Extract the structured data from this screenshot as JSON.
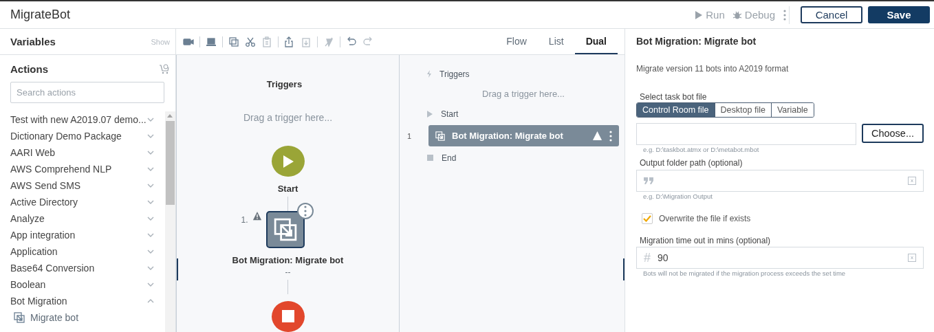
{
  "app": {
    "title": "MigrateBot"
  },
  "header_actions": {
    "run": "Run",
    "debug": "Debug",
    "cancel": "Cancel",
    "save": "Save"
  },
  "sidebar": {
    "variables_title": "Variables",
    "variables_toggle": "Show",
    "actions_title": "Actions",
    "search": {
      "placeholder": "Search actions"
    },
    "items": [
      {
        "label": "Test with new A2019.07 demo...",
        "expanded": false
      },
      {
        "label": "Dictionary Demo Package",
        "expanded": false
      },
      {
        "label": "AARI Web",
        "expanded": false
      },
      {
        "label": "AWS Comprehend NLP",
        "expanded": false
      },
      {
        "label": "AWS Send SMS",
        "expanded": false
      },
      {
        "label": "Active Directory",
        "expanded": false
      },
      {
        "label": "Analyze",
        "expanded": false
      },
      {
        "label": "App integration",
        "expanded": false
      },
      {
        "label": "Application",
        "expanded": false
      },
      {
        "label": "Base64 Conversion",
        "expanded": false
      },
      {
        "label": "Boolean",
        "expanded": false
      },
      {
        "label": "Bot Migration",
        "expanded": true,
        "children": [
          {
            "label": "Migrate bot"
          }
        ]
      }
    ]
  },
  "tabs": [
    {
      "label": "Flow",
      "selected": false
    },
    {
      "label": "List",
      "selected": false
    },
    {
      "label": "Dual",
      "selected": true
    }
  ],
  "flow": {
    "triggers_title": "Triggers",
    "trigger_hint": "Drag a trigger here...",
    "start_label": "Start",
    "step": {
      "number": "1.",
      "label": "Bot Migration: Migrate bot",
      "subtitle": "--",
      "warning": true,
      "selected": true
    }
  },
  "list": {
    "triggers": "Triggers",
    "trigger_hint": "Drag a trigger here...",
    "start": "Start",
    "rows": [
      {
        "number": "1",
        "label": "Bot Migration: Migrate bot",
        "warning": true,
        "selected": true
      }
    ],
    "end": "End"
  },
  "properties": {
    "title": "Bot Migration: Migrate bot",
    "description": "Migrate version 11 bots into A2019 format",
    "file_label": "Select task bot file",
    "file_sources": [
      {
        "label": "Control Room file",
        "selected": true
      },
      {
        "label": "Desktop file",
        "selected": false
      },
      {
        "label": "Variable",
        "selected": false
      }
    ],
    "choose": "Choose...",
    "file_hint": "e.g. D:\\taskbot.atmx or D:\\metabot.mbot",
    "output_label": "Output folder path (optional)",
    "output_hint": "e.g. D:\\Migration Output",
    "overwrite": {
      "label": "Overwrite the file if exists",
      "checked": true
    },
    "timeout_label": "Migration time out in mins (optional)",
    "timeout_prefix": "#",
    "timeout_value": "90",
    "timeout_hint": "Bots will not be migrated if the migration process exceeds the set time"
  }
}
